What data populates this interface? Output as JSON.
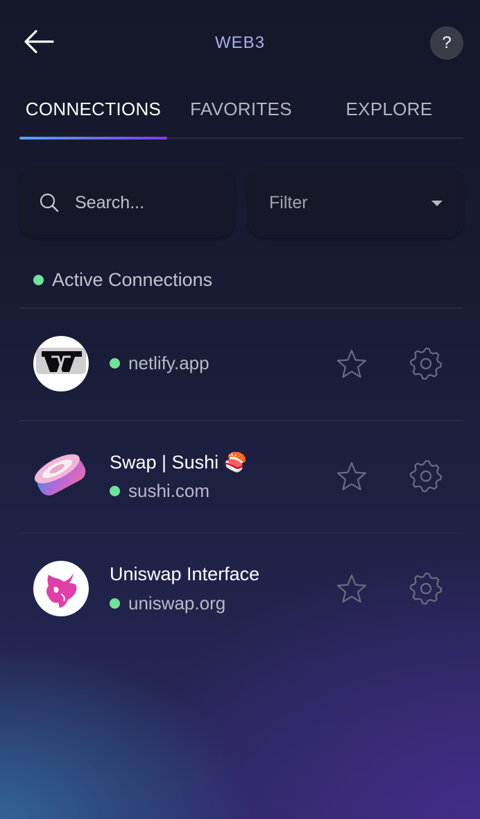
{
  "header": {
    "title": "WEB3",
    "back_icon": "arrow-left-icon",
    "help_label": "?"
  },
  "tabs": [
    {
      "label": "CONNECTIONS",
      "active": true
    },
    {
      "label": "FAVORITES",
      "active": false
    },
    {
      "label": "EXPLORE",
      "active": false
    }
  ],
  "search": {
    "placeholder": "Search...",
    "value": ""
  },
  "filter": {
    "label": "Filter",
    "icon": "caret-down-icon"
  },
  "section": {
    "label": "Active Connections",
    "status_color": "#6fe39a"
  },
  "connections": [
    {
      "title": "",
      "url": "netlify.app",
      "logo": "netlify-app-logo",
      "favorited": false
    },
    {
      "title": "Swap | Sushi 🍣",
      "url": "sushi.com",
      "logo": "sushi-logo",
      "favorited": false
    },
    {
      "title": "Uniswap Interface",
      "url": "uniswap.org",
      "logo": "uniswap-logo",
      "favorited": false
    }
  ],
  "colors": {
    "accent_gradient_start": "#5aa2f0",
    "accent_gradient_end": "#7a3cf0",
    "active_dot": "#6fe39a",
    "title_text": "#aab0ec"
  }
}
